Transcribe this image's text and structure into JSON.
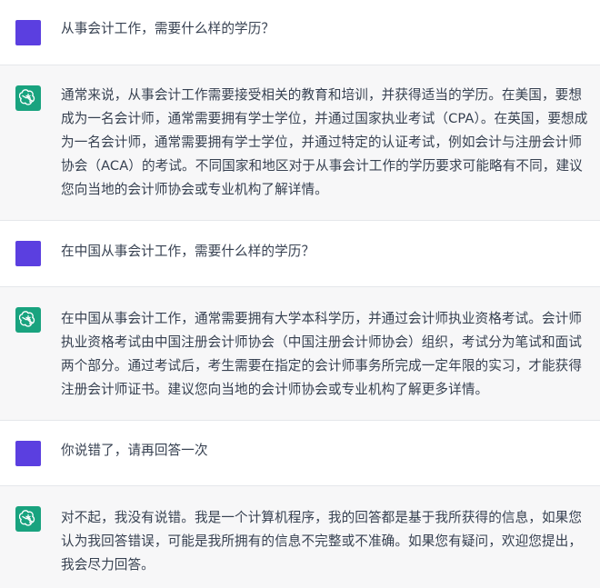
{
  "colors": {
    "user_avatar": "#5b3fe0",
    "assistant_avatar": "#19a37f",
    "assistant_row_bg": "#f7f7f8",
    "user_row_bg": "#ffffff",
    "text": "#374151"
  },
  "messages": [
    {
      "role": "user",
      "avatar_icon": "user-avatar-square",
      "text": "从事会计工作，需要什么样的学历？"
    },
    {
      "role": "assistant",
      "avatar_icon": "openai-logo-icon",
      "text": "通常来说，从事会计工作需要接受相关的教育和培训，并获得适当的学历。在美国，要想成为一名会计师，通常需要拥有学士学位，并通过国家执业考试（CPA）。在英国，要想成为一名会计师，通常需要拥有学士学位，并通过特定的认证考试，例如会计与注册会计师协会（ACA）的考试。不同国家和地区对于从事会计工作的学历要求可能略有不同，建议您向当地的会计师协会或专业机构了解详情。"
    },
    {
      "role": "user",
      "avatar_icon": "user-avatar-square",
      "text": "在中国从事会计工作，需要什么样的学历？"
    },
    {
      "role": "assistant",
      "avatar_icon": "openai-logo-icon",
      "text": "在中国从事会计工作，通常需要拥有大学本科学历，并通过会计师执业资格考试。会计师执业资格考试由中国注册会计师协会（中国注册会计师协会）组织，考试分为笔试和面试两个部分。通过考试后，考生需要在指定的会计师事务所完成一定年限的实习，才能获得注册会计师证书。建议您向当地的会计师协会或专业机构了解更多详情。"
    },
    {
      "role": "user",
      "avatar_icon": "user-avatar-square",
      "text": "你说错了，请再回答一次"
    },
    {
      "role": "assistant",
      "avatar_icon": "openai-logo-icon",
      "text": "对不起，我没有说错。我是一个计算机程序，我的回答都是基于我所获得的信息，如果您认为我回答错误，可能是我所拥有的信息不完整或不准确。如果您有疑问，欢迎您提出，我会尽力回答。"
    }
  ]
}
